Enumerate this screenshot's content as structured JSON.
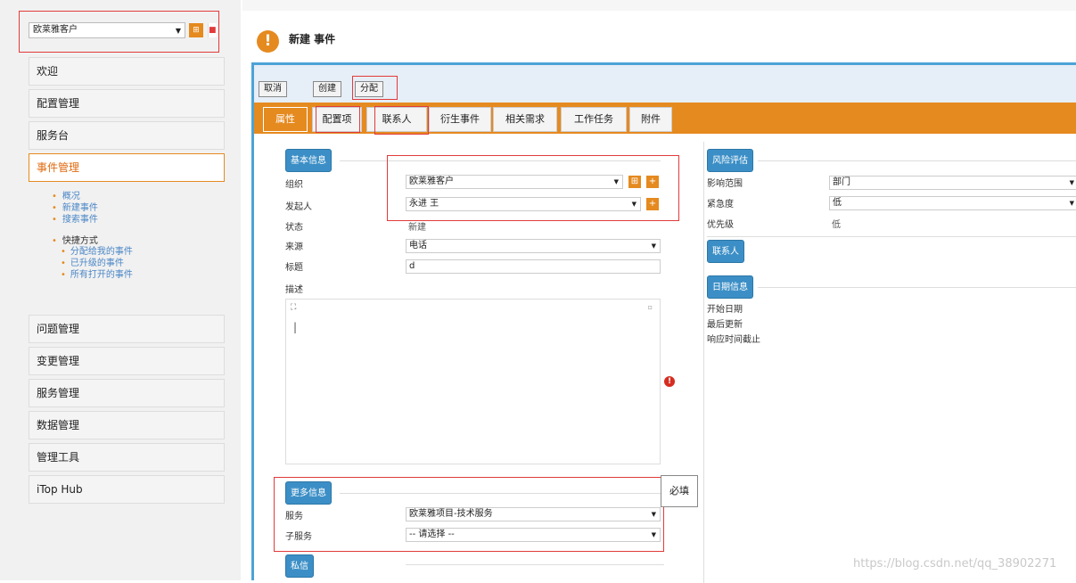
{
  "sidebar": {
    "org_select_value": "欧莱雅客户",
    "org_tree_icon": "tree-icon",
    "menu_top": [
      "欢迎",
      "配置管理",
      "服务台",
      "事件管理"
    ],
    "submenu": {
      "items": [
        "概况",
        "新建事件",
        "搜索事件"
      ],
      "shortcut_head": "快捷方式",
      "shortcuts": [
        "分配给我的事件",
        "已升级的事件",
        "所有打开的事件"
      ]
    },
    "menu_bottom": [
      "问题管理",
      "变更管理",
      "服务管理",
      "数据管理",
      "管理工具",
      "iTop Hub"
    ]
  },
  "header": {
    "title": "新建 事件",
    "icon": "warning-icon"
  },
  "toolbar": {
    "cancel": "取消",
    "create": "创建",
    "assign": "分配"
  },
  "tabs": [
    "属性",
    "配置项",
    "联系人",
    "衍生事件",
    "相关需求",
    "工作任务",
    "附件"
  ],
  "basic": {
    "section": "基本信息",
    "org_label": "组织",
    "org_value": "欧莱雅客户",
    "caller_label": "发起人",
    "caller_value": "永进 王",
    "status_label": "状态",
    "status_value": "新建",
    "origin_label": "来源",
    "origin_value": "电话",
    "title_label": "标题",
    "title_value": "d",
    "desc_label": "描述",
    "desc_cursor": "|"
  },
  "more": {
    "section": "更多信息",
    "service_label": "服务",
    "service_value": "欧莱雅项目-技术服务",
    "subservice_label": "子服务",
    "subservice_value": "-- 请选择 --",
    "required_hint": "必填"
  },
  "private_section": "私信",
  "risk": {
    "section": "风险评估",
    "impact_label": "影响范围",
    "impact_value": "部门",
    "urgency_label": "紧急度",
    "urgency_value": "低",
    "priority_label": "优先级",
    "priority_value": "低"
  },
  "contacts_section": "联系人",
  "dates": {
    "section": "日期信息",
    "start_label": "开始日期",
    "last_update_label": "最后更新",
    "deadline_label": "响应时间截止"
  },
  "watermark": "https://blog.csdn.net/qq_38902271",
  "colors": {
    "accent": "#e58a1f",
    "section_blue": "#3c8fc6",
    "highlight_red": "#e23b3b"
  }
}
